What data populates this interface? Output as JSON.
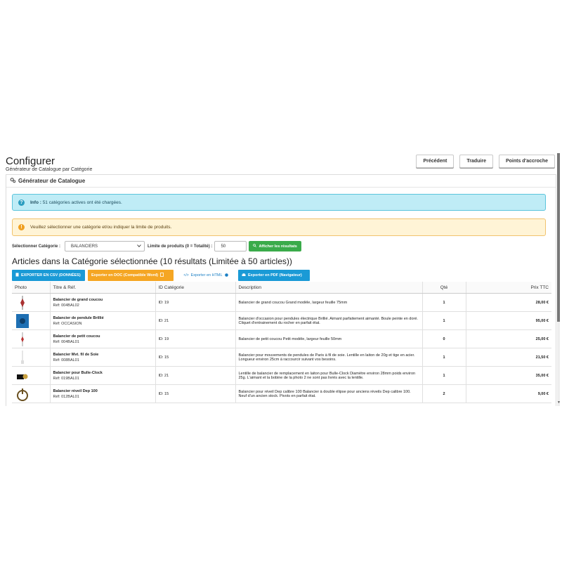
{
  "header": {
    "title": "Configurer",
    "subtitle": "Générateur de Catalogue par Catégorie",
    "buttons": {
      "prev": "Précédent",
      "translate": "Traduire",
      "hooks": "Points d'accroche"
    }
  },
  "panel": {
    "title": "Générateur de Catalogue",
    "icon": "gears-icon"
  },
  "alerts": {
    "info": {
      "bold": "Info :",
      "text": " 51 catégories actives ont été chargées."
    },
    "warning": {
      "text": "Veuillez sélectionner une catégorie et/ou indiquer la limite de produits."
    }
  },
  "filters": {
    "category_label": "Sélectionner Catégorie :",
    "category_value": "BALANCIERS",
    "limit_label": "Limite de produits (0 = Totalité) :",
    "limit_value": "50",
    "show_button": "Afficher les résultats"
  },
  "section_title": "Articles dans la Catégorie sélectionnée (10 résultats (Limitée à 50 articles))",
  "exports": {
    "csv": "EXPORTER EN CSV (DONNÉES)",
    "doc": "Exporter en DOC (Compatible Word)",
    "html": "Exporter en HTML",
    "pdf": "Exporter en PDF (Navigateur)"
  },
  "table": {
    "headers": {
      "photo": "Photo",
      "title": "Titre & Réf.",
      "cat": "ID Catégorie",
      "desc": "Description",
      "qty": "Qté",
      "price": "Prix TTC"
    },
    "rows": [
      {
        "name": "Balancier de grand coucou",
        "ref": "Réf: 004BAL02",
        "cat": "ID: 19",
        "desc": "Balancier de grand coucou Grand modèle, largeur feuille 75mm",
        "qty": "1",
        "price": "28,00 €"
      },
      {
        "name": "Balancier de pendule Brillié",
        "ref": "Réf: OCCASION",
        "cat": "ID: 21",
        "desc": "Balancier d'occasion pour pendules électrique Brillié. Aimant parfaitement aimanté. Boule peinte en doré. Cliquet d'entrainement du rocher en parfait état.",
        "qty": "1",
        "price": "95,00 €"
      },
      {
        "name": "Balancier de petit coucou",
        "ref": "Réf: 004BAL01",
        "cat": "ID: 19",
        "desc": "Balancier de petit coucou Petit modèle, largeur feuille 50mm",
        "qty": "0",
        "price": "25,00 €"
      },
      {
        "name": "Balancier Mvt. fil de Soie",
        "ref": "Réf: 008BAL01",
        "cat": "ID: 15",
        "desc": "Balancier pour mouvements de pendules de Paris à fil de soie. Lentille en laiton de 20g et tige en acier. Longueur environ 25cm à raccourcir suivant vos besoins.",
        "qty": "1",
        "price": "21,50 €"
      },
      {
        "name": "Balancier pour Bulle-Clock",
        "ref": "Réf: 019BAL01",
        "cat": "ID: 21",
        "desc": "Lentille de balancier de remplacement en laiton pour Bulle-Clock Diamètre environ 28mm poids environ 25g. L'aimant et la bobine de la photo 2 ne sont pas livrés avec la lentille.",
        "qty": "1",
        "price": "35,00 €"
      },
      {
        "name": "Balancier réveil Dep 100",
        "ref": "Réf: 012BAL01",
        "cat": "ID: 15",
        "desc": "Balancier pour réveil Dep calibre 100 Balancier à double élipse pour anciens réveils Dep calibre 100. Neuf d'un ancien stock. Pivots en parfait état.",
        "qty": "2",
        "price": "9,00 €"
      }
    ]
  },
  "colors": {
    "info_bg": "#bfecf6",
    "warn_bg": "#fff4d6",
    "green": "#3aab4a",
    "blue": "#1a9ad6",
    "orange": "#f5a623"
  }
}
